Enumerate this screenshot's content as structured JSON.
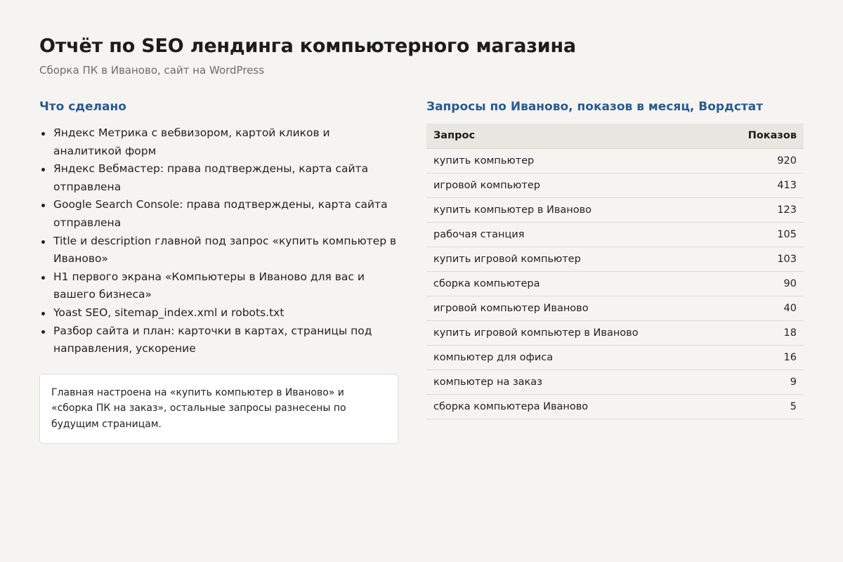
{
  "header": {
    "title": "Отчёт по SEO лендинга компьютерного магазина",
    "subtitle": "Сборка ПК в Иваново, сайт на WordPress"
  },
  "done": {
    "heading": "Что сделано",
    "items": [
      "Яндекс Метрика с вебвизором, картой кликов и аналитикой форм",
      "Яндекс Вебмастер: права подтверждены, карта сайта отправлена",
      "Google Search Console: права подтверждены, карта сайта отправлена",
      "Title и description главной под запрос «купить компьютер в Иваново»",
      "H1 первого экрана «Компьютеры в Иваново для вас и вашего бизнеса»",
      "Yoast SEO, sitemap_index.xml и robots.txt",
      "Разбор сайта и план: карточки в картах, страницы под направления, ускорение"
    ],
    "note": "Главная настроена на «купить компьютер в Иваново» и «сборка ПК на заказ», остальные запросы разнесены по будущим страницам."
  },
  "queries": {
    "heading": "Запросы по Иваново, показов в месяц, Вордстат",
    "columns": [
      "Запрос",
      "Показов"
    ],
    "rows": [
      {
        "query": "купить компьютер",
        "shows": "920"
      },
      {
        "query": "игровой компьютер",
        "shows": "413"
      },
      {
        "query": "купить компьютер в Иваново",
        "shows": "123"
      },
      {
        "query": "рабочая станция",
        "shows": "105"
      },
      {
        "query": "купить игровой компьютер",
        "shows": "103"
      },
      {
        "query": "сборка компьютера",
        "shows": "90"
      },
      {
        "query": "игровой компьютер Иваново",
        "shows": "40"
      },
      {
        "query": "купить игровой компьютер в Иваново",
        "shows": "18"
      },
      {
        "query": "компьютер для офиса",
        "shows": "16"
      },
      {
        "query": "компьютер на заказ",
        "shows": "9"
      },
      {
        "query": "сборка компьютера Иваново",
        "shows": "5"
      }
    ]
  },
  "colors": {
    "background": "#f5f4f1",
    "heading_accent": "#2b5a8c",
    "table_header_bg": "#e8e6e0",
    "note_bg": "#ffffff"
  }
}
